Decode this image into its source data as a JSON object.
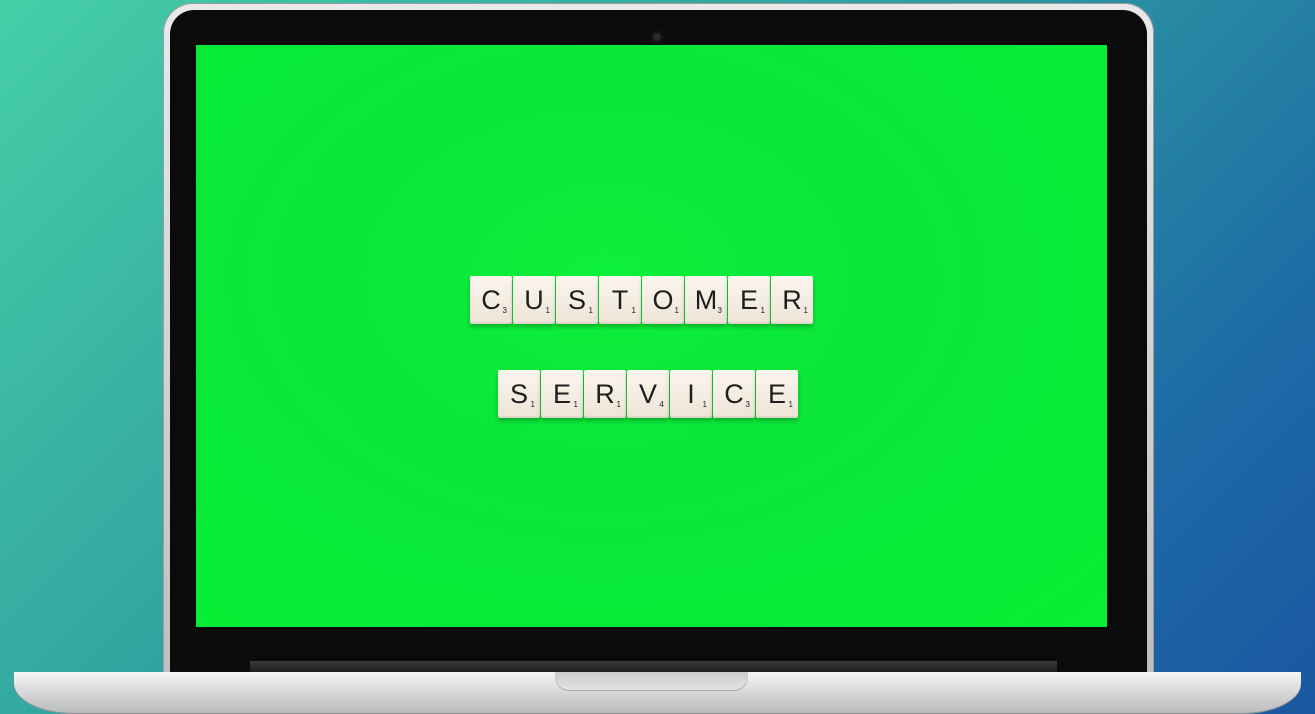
{
  "screen": {
    "background_color": "#07f033",
    "tiles": {
      "row1": [
        {
          "letter": "C",
          "score": "3"
        },
        {
          "letter": "U",
          "score": "1"
        },
        {
          "letter": "S",
          "score": "1"
        },
        {
          "letter": "T",
          "score": "1"
        },
        {
          "letter": "O",
          "score": "1"
        },
        {
          "letter": "M",
          "score": "3"
        },
        {
          "letter": "E",
          "score": "1"
        },
        {
          "letter": "R",
          "score": "1"
        }
      ],
      "row2": [
        {
          "letter": "S",
          "score": "1"
        },
        {
          "letter": "E",
          "score": "1"
        },
        {
          "letter": "R",
          "score": "1"
        },
        {
          "letter": "V",
          "score": "4"
        },
        {
          "letter": "I",
          "score": "1"
        },
        {
          "letter": "C",
          "score": "3"
        },
        {
          "letter": "E",
          "score": "1"
        }
      ]
    }
  }
}
